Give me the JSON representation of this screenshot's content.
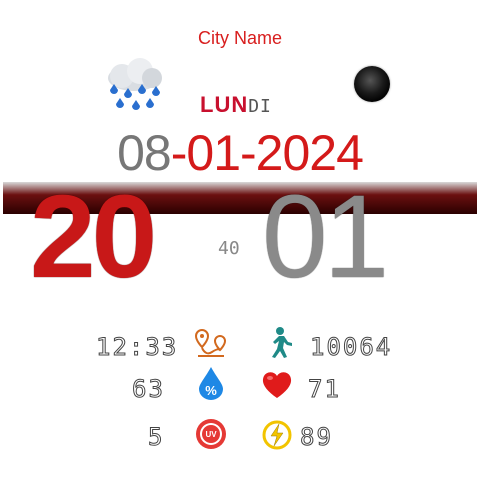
{
  "city": "City Name",
  "weather": {
    "icon": "rain-cloud-icon"
  },
  "moon": {
    "icon": "moon-phase-icon"
  },
  "day": {
    "main": "LUN",
    "tail": "DI"
  },
  "date": {
    "day": "08",
    "sep1": "-",
    "rest": "01-2024"
  },
  "time": {
    "hour": "20",
    "minute": "01",
    "seconds": "40"
  },
  "stats": {
    "sunset": "12:33",
    "steps": "10064",
    "humidity": "63",
    "heart_rate": "71",
    "uv": "5",
    "battery": "89"
  },
  "colors": {
    "accent": "#d81e1e",
    "dark_accent": "#6b1010",
    "gray": "#8a8a8a"
  }
}
